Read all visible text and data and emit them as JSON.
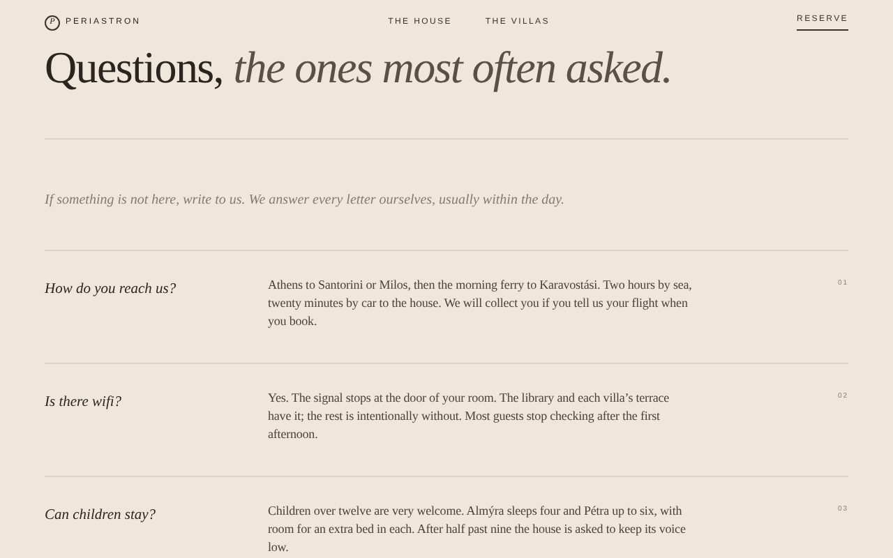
{
  "brand": {
    "mark": "P",
    "name": "PERIASTRON"
  },
  "nav": [
    {
      "label": "THE HOUSE"
    },
    {
      "label": "THE VILLAS"
    }
  ],
  "reserve": "RESERVE",
  "title": {
    "plain": "Questions,",
    "italic": "the ones most often asked."
  },
  "intro": "If something is not here, write to us. We answer every letter ourselves, usually within the day.",
  "faqs": [
    {
      "question": "How do you reach us?",
      "answer": "Athens to Santorini or Milos, then the morning ferry to Karavostási. Two hours by sea, twenty minutes by car to the house. We will collect you if you tell us your flight when you book.",
      "number": "01"
    },
    {
      "question": "Is there wifi?",
      "answer": "Yes. The signal stops at the door of your room. The library and each villa’s terrace have it; the rest is intentionally without. Most guests stop checking after the first afternoon.",
      "number": "02"
    },
    {
      "question": "Can children stay?",
      "answer": "Children over twelve are very welcome. Almýra sleeps four and Pétra up to six, with room for an extra bed in each. After half past nine the house is asked to keep its voice low.",
      "number": "03"
    }
  ]
}
